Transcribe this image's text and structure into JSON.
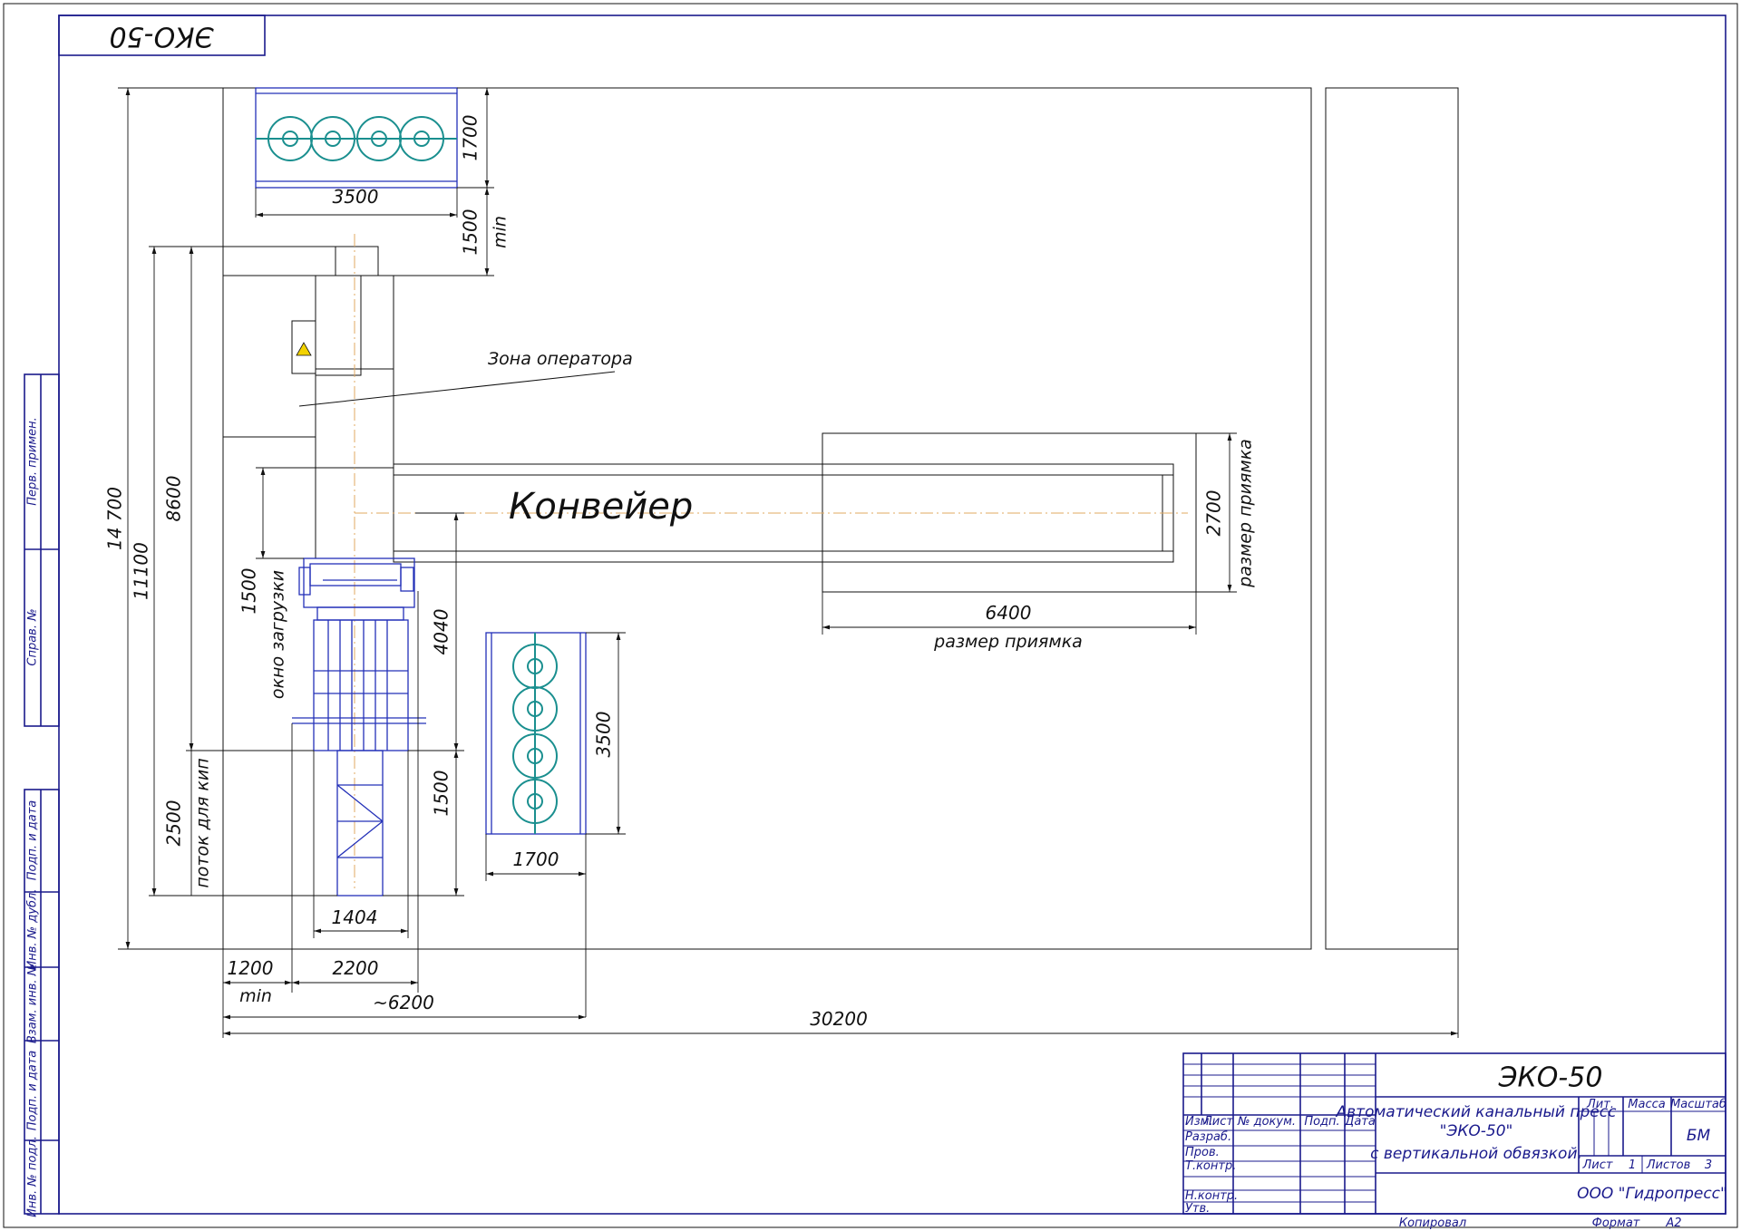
{
  "drawing_code": "ЭКО-50",
  "labels": {
    "operator_zone": "Зона оператора",
    "conveyor": "Конвейер",
    "pit_size": "размер приямка",
    "loading_window": "окно загрузки",
    "bale_flow": "поток для кип",
    "min": "min"
  },
  "dimensions": {
    "d14700": "14 700",
    "d11100": "11100",
    "d8600": "8600",
    "d1500_window": "1500",
    "d2500": "2500",
    "d3500_top": "3500",
    "d1700_top": "1700",
    "d1500_min": "1500",
    "d4040": "4040",
    "d1500_mid": "1500",
    "d3500_rolls": "3500",
    "d1700_rolls": "1700",
    "d2700": "2700",
    "d6400": "6400",
    "d1404": "1404",
    "d1200": "1200",
    "d2200": "2200",
    "d6200": "~6200",
    "d30200": "30200"
  },
  "title_block": {
    "title": "ЭКО-50",
    "description_line1": "Автоматический канальный пресс",
    "description_line2": "\"ЭКО-50\"",
    "description_line3": "с вертикальной обвязкой.",
    "col_izm": "Изм.",
    "col_list": "Лист",
    "col_doc": "№ докум.",
    "col_sign": "Подп.",
    "col_date": "Дата",
    "row_razrab": "Разраб.",
    "row_prov": "Пров.",
    "row_tkontr": "Т.контр.",
    "row_nkontr": "Н.контр.",
    "row_utv": "Утв.",
    "lit": "Лит.",
    "massa": "Масса",
    "masshtab": "Масштаб",
    "scale_value": "БМ",
    "sheet_label": "Лист",
    "sheet_value": "1",
    "sheets_label": "Листов",
    "sheets_value": "3",
    "company": "ООО \"Гидропресс\"",
    "kopiroval": "Копировал",
    "format_label": "Формат",
    "format_value": "А2"
  },
  "side_stamps": {
    "perv_primen": "Перв. примен.",
    "sprav_no": "Справ. №",
    "podp_data_1": "Подп. и дата",
    "inv_dubl": "Инв. № дубл.",
    "vzam_inv": "Взам. инв. №",
    "podp_data_2": "Подп. и дата",
    "inv_podl": "Инв. № подл."
  },
  "colors": {
    "frame": "#1a1a8c",
    "equipment": "#2330b8",
    "rolls": "#1a8f8f",
    "centerline": "#e0a860",
    "warning": "#f2d200"
  }
}
